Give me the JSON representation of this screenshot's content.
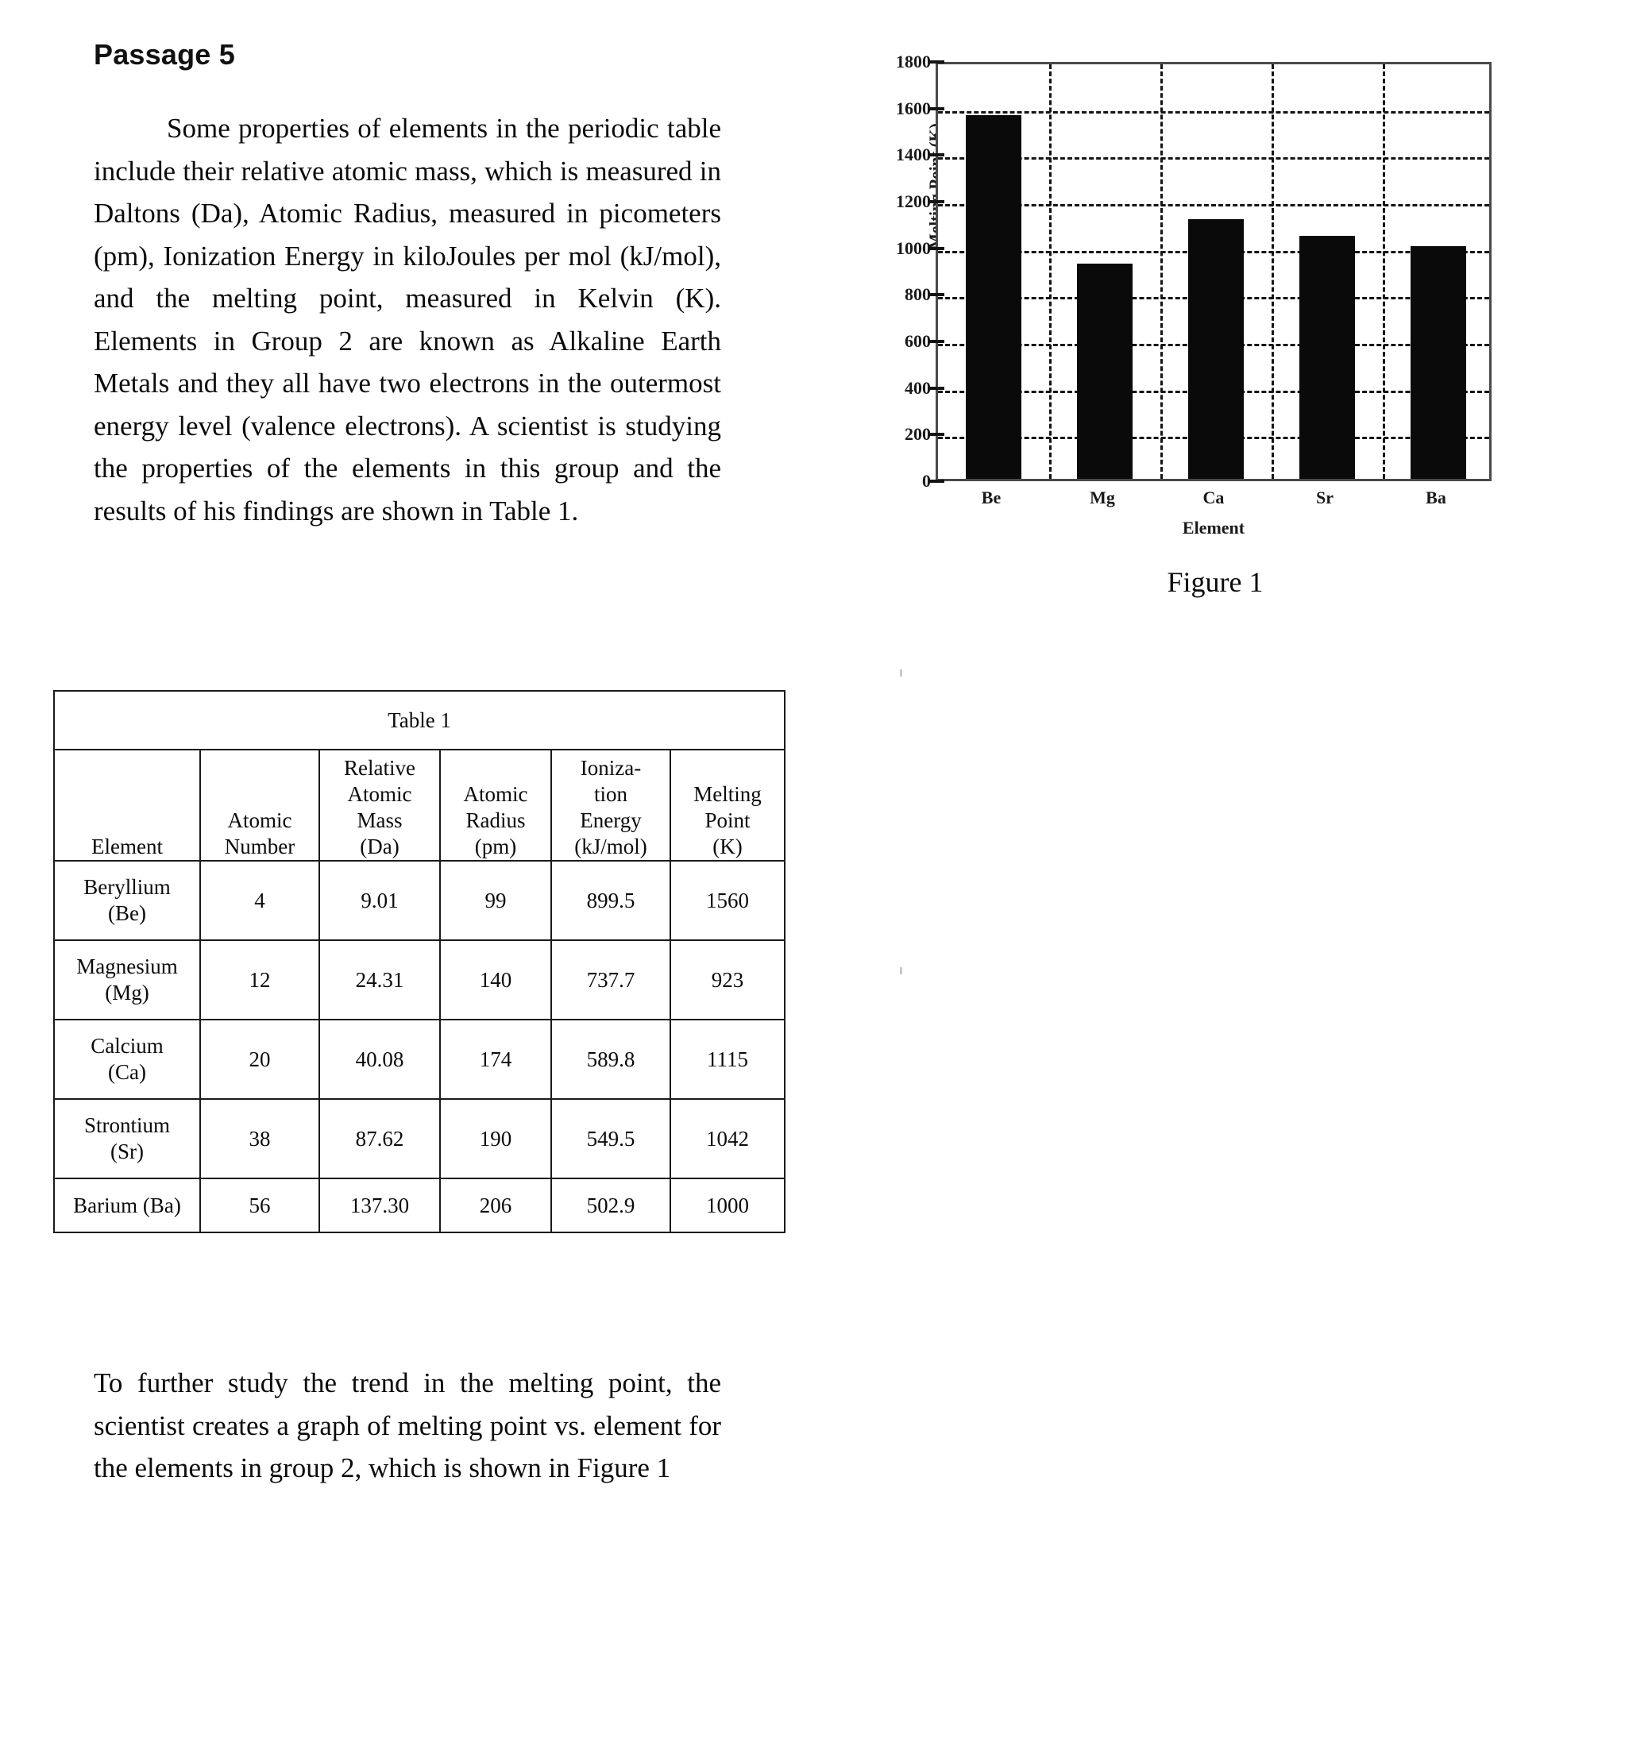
{
  "heading": "Passage 5",
  "intro_paragraph": "Some properties of elements in the periodic table include their relative atomic mass, which is measured in Daltons (Da), Atomic Radius, measured in picometers (pm), Ionization Energy in kiloJoules per mol (kJ/mol), and the melting point, measured in Kelvin (K). Elements in Group 2 are known as Alkaline Earth Metals and they all have two electrons in the outermost energy level (valence electrons). A scientist is studying the properties of the elements in this group and the results of his findings are shown in Table 1.",
  "closing_paragraph": "To further study the trend in the melting point, the scientist creates a graph of melting point vs. element for the elements in group 2, which is shown in Figure 1",
  "table": {
    "caption": "Table 1",
    "headers": [
      "Element",
      "Atomic Number",
      "Relative Atomic Mass (Da)",
      "Atomic Radius (pm)",
      "Ioniza- tion Energy (kJ/mol)",
      "Melting Point (K)"
    ],
    "header_lines": [
      [
        "Element"
      ],
      [
        "Atomic",
        "Number"
      ],
      [
        "Relative",
        "Atomic",
        "Mass",
        "(Da)"
      ],
      [
        "Atomic",
        "Radius",
        "(pm)"
      ],
      [
        "Ioniza-",
        "tion",
        "Energy",
        "(kJ/mol)"
      ],
      [
        "Melting",
        "Point",
        "(K)"
      ]
    ],
    "rows": [
      {
        "element_line1": "Beryllium",
        "element_line2": "(Be)",
        "atomic_number": "4",
        "relative_atomic_mass": "9.01",
        "atomic_radius": "99",
        "ionization_energy": "899.5",
        "melting_point": "1560"
      },
      {
        "element_line1": "Magnesium",
        "element_line2": "(Mg)",
        "atomic_number": "12",
        "relative_atomic_mass": "24.31",
        "atomic_radius": "140",
        "ionization_energy": "737.7",
        "melting_point": "923"
      },
      {
        "element_line1": "Calcium",
        "element_line2": "(Ca)",
        "atomic_number": "20",
        "relative_atomic_mass": "40.08",
        "atomic_radius": "174",
        "ionization_energy": "589.8",
        "melting_point": "1115"
      },
      {
        "element_line1": "Strontium",
        "element_line2": "(Sr)",
        "atomic_number": "38",
        "relative_atomic_mass": "87.62",
        "atomic_radius": "190",
        "ionization_energy": "549.5",
        "melting_point": "1042"
      },
      {
        "element_line1": "Barium (Ba)",
        "element_line2": "",
        "atomic_number": "56",
        "relative_atomic_mass": "137.30",
        "atomic_radius": "206",
        "ionization_energy": "502.9",
        "melting_point": "1000"
      }
    ]
  },
  "figure": {
    "caption": "Figure 1"
  },
  "chart_data": {
    "type": "bar",
    "title": "",
    "xlabel": "Element",
    "ylabel": "Melting Point (K)",
    "categories": [
      "Be",
      "Mg",
      "Ca",
      "Sr",
      "Ba"
    ],
    "values": [
      1560,
      923,
      1115,
      1042,
      1000
    ],
    "ylim": [
      0,
      1800
    ],
    "yticks": [
      0,
      200,
      400,
      600,
      800,
      1000,
      1200,
      1400,
      1600,
      1800
    ],
    "ytick_labels": [
      "0",
      "200",
      "400",
      "600",
      "800",
      "1000",
      "1200",
      "1400",
      "1600",
      "1800"
    ],
    "grid": "dashed-both",
    "legend": "none",
    "bar_color": "#0a0a0a"
  }
}
